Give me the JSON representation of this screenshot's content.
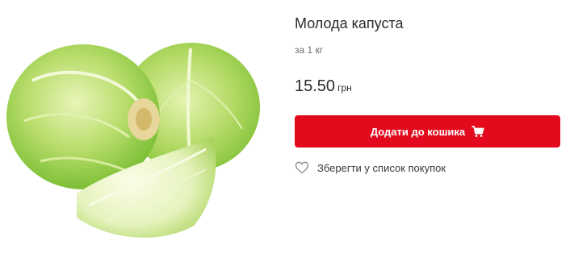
{
  "product": {
    "title": "Молода капуста",
    "unit": "за 1 кг",
    "price": "15.50",
    "currency": "грн",
    "image": "cabbage-image"
  },
  "actions": {
    "add_to_cart_label": "Додати до кошика",
    "add_to_cart_icon": "cart-icon",
    "save_to_list_label": "Зберегти у список покупок",
    "save_icon": "heart-icon"
  },
  "colors": {
    "accent": "#e30a1d",
    "text": "#2b2b2b",
    "muted": "#6b6b6b"
  }
}
